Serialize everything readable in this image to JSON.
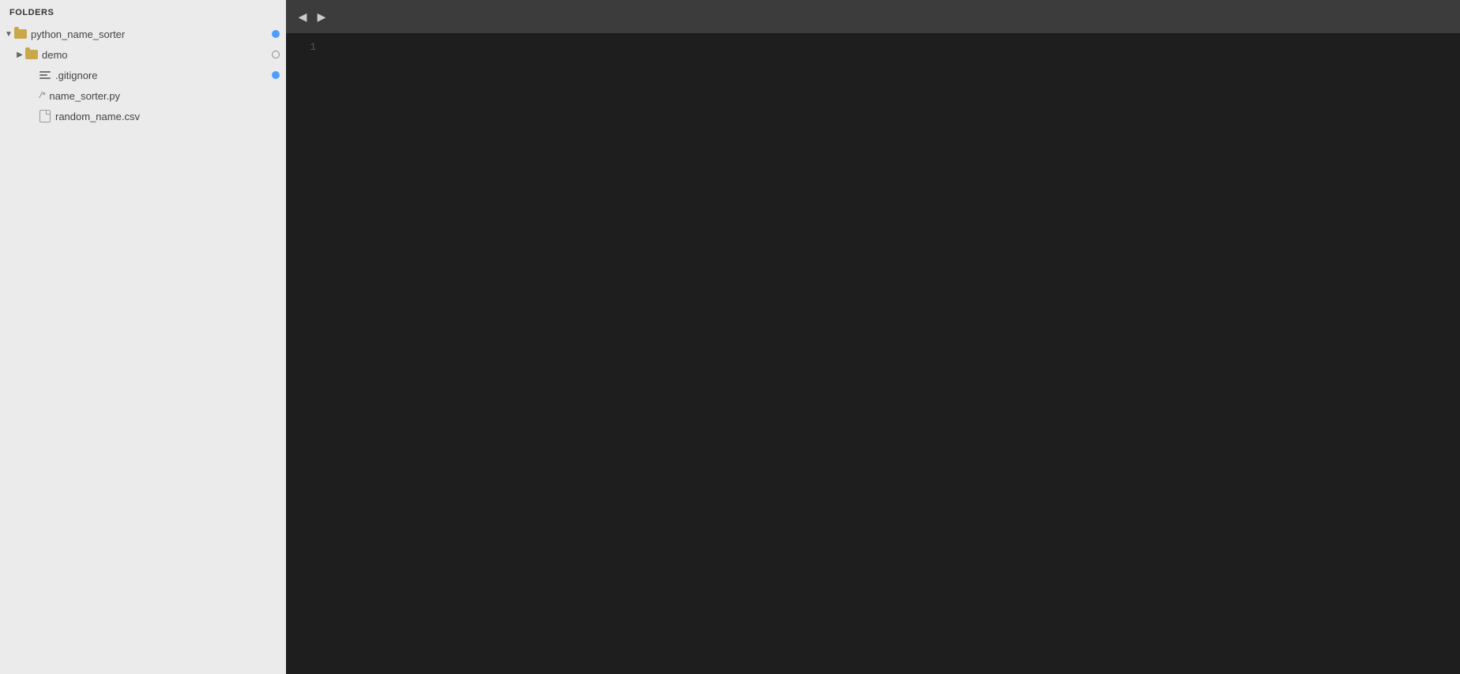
{
  "sidebar": {
    "header": "FOLDERS",
    "items": [
      {
        "id": "python_name_sorter",
        "name": "python_name_sorter",
        "type": "folder",
        "expanded": true,
        "indent": 0,
        "hasArrow": true,
        "arrowDown": true,
        "badge": "blue"
      },
      {
        "id": "demo",
        "name": "demo",
        "type": "folder",
        "expanded": false,
        "indent": 1,
        "hasArrow": true,
        "arrowDown": false,
        "badge": "outline"
      },
      {
        "id": ".gitignore",
        "name": ".gitignore",
        "type": "gitignore",
        "indent": 1,
        "hasArrow": false,
        "badge": "blue"
      },
      {
        "id": "name_sorter.py",
        "name": "name_sorter.py",
        "type": "python",
        "indent": 1,
        "hasArrow": false,
        "badge": "none"
      },
      {
        "id": "random_name.csv",
        "name": "random_name.csv",
        "type": "csv",
        "indent": 1,
        "hasArrow": false,
        "badge": "none"
      }
    ]
  },
  "editor": {
    "toolbar": {
      "back_label": "◀",
      "forward_label": "▶"
    },
    "lines": [
      1
    ]
  }
}
